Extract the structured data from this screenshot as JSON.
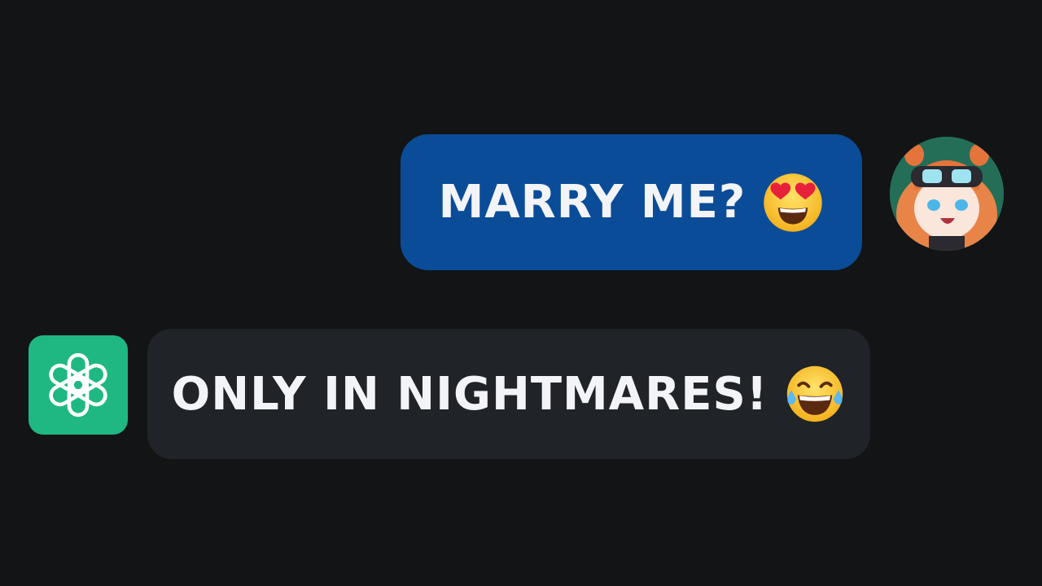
{
  "messages": [
    {
      "role": "user",
      "text": "MARRY ME?",
      "emoji": "heart-eyes-emoji",
      "bubble_color": "#0b4c98"
    },
    {
      "role": "assistant",
      "text": "ONLY IN NIGHTMARES!",
      "emoji": "tears-of-joy-emoji",
      "bubble_color": "#202328"
    }
  ],
  "user_avatar": {
    "icon": "anime-character-avatar"
  },
  "assistant_avatar": {
    "icon": "openai-logo-icon",
    "color": "#1fb882"
  },
  "colors": {
    "background": "#131416",
    "text": "#f2f4f7"
  }
}
